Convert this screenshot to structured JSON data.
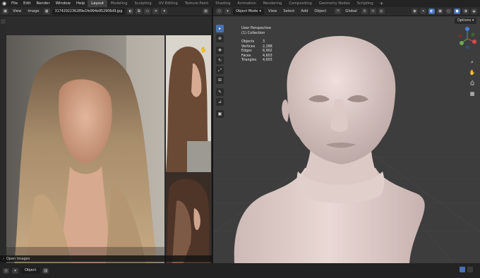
{
  "topbar": {
    "menus": [
      "File",
      "Edit",
      "Render",
      "Window",
      "Help"
    ],
    "workspaces": [
      "Layout",
      "Modeling",
      "Sculpting",
      "UV Editing",
      "Texture Paint",
      "Shading",
      "Animation",
      "Rendering",
      "Compositing",
      "Geometry Nodes",
      "Scripting"
    ],
    "active_workspace": "Layout"
  },
  "image_editor": {
    "view_label": "View",
    "image_label": "Image",
    "filename": "3174292236289e1fe994e952906d9.jpg",
    "open_images_label": "Open Images"
  },
  "viewport": {
    "mode": "Object Mode",
    "menus": [
      "View",
      "Select",
      "Add",
      "Object"
    ],
    "transform_orientation": "Global",
    "options_label": "Options",
    "perspective_label": "User Perspective",
    "collection_label": "(1) Collection",
    "stats": [
      {
        "label": "Objects",
        "value": "3"
      },
      {
        "label": "Vertices",
        "value": "2,288"
      },
      {
        "label": "Edges",
        "value": "6,902"
      },
      {
        "label": "Faces",
        "value": "4,603"
      },
      {
        "label": "Triangles",
        "value": "4,603"
      }
    ],
    "gizmo_axes": {
      "x": "#d84a4a",
      "y": "#6aa84f",
      "z": "#4a7fd8"
    }
  },
  "statusbar": {
    "object_select": "Object"
  },
  "colors": {
    "accent": "#4772b3",
    "skin": "#e6d3d0"
  }
}
